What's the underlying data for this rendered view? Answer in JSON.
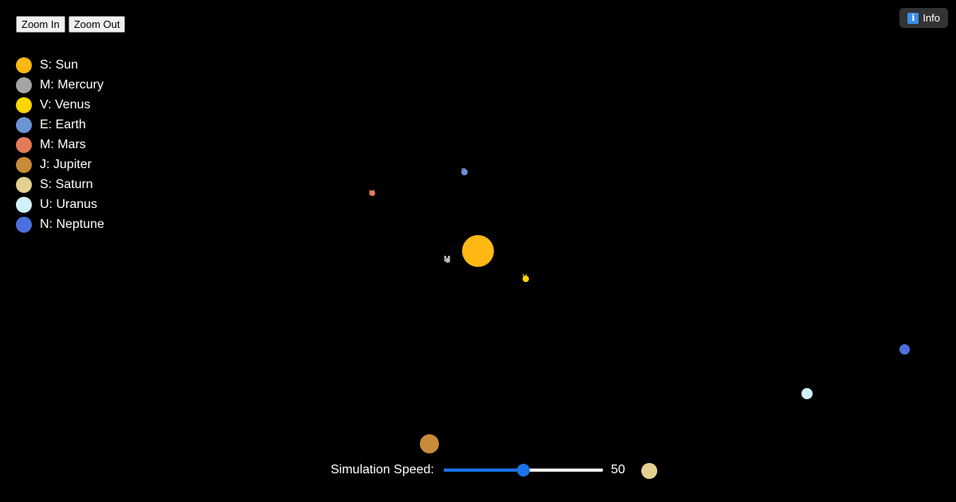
{
  "controls": {
    "zoom_in_label": "Zoom In",
    "zoom_out_label": "Zoom Out",
    "info_label": "Info",
    "info_icon": "info-icon"
  },
  "legend": [
    {
      "label": "S: Sun",
      "color": "#FDB813"
    },
    {
      "label": "M: Mercury",
      "color": "#A5A5A5"
    },
    {
      "label": "V: Venus",
      "color": "#FFD700"
    },
    {
      "label": "E: Earth",
      "color": "#6B93D6"
    },
    {
      "label": "M: Mars",
      "color": "#E27B58"
    },
    {
      "label": "J: Jupiter",
      "color": "#C88B3A"
    },
    {
      "label": "S: Saturn",
      "color": "#E4D191"
    },
    {
      "label": "U: Uranus",
      "color": "#D1F0FA"
    },
    {
      "label": "N: Neptune",
      "color": "#4B70DD"
    }
  ],
  "bodies": [
    {
      "name": "sun",
      "color": "#FDB813",
      "label": ""
    },
    {
      "name": "mercury",
      "color": "#A5A5A5",
      "label": "M"
    },
    {
      "name": "venus",
      "color": "#FFD700",
      "label": "V"
    },
    {
      "name": "earth",
      "color": "#6B93D6",
      "label": "E"
    },
    {
      "name": "mars",
      "color": "#E27B58",
      "label": "M"
    },
    {
      "name": "jupiter",
      "color": "#C88B3A",
      "label": ""
    },
    {
      "name": "saturn",
      "color": "#E4D191",
      "label": ""
    },
    {
      "name": "uranus",
      "color": "#D1F0FA",
      "label": ""
    },
    {
      "name": "neptune",
      "color": "#4B70DD",
      "label": ""
    }
  ],
  "simulation": {
    "speed_label": "Simulation Speed:",
    "speed_value": "50",
    "speed_min": 0,
    "speed_max": 100,
    "accent_color": "#1A73E8"
  }
}
